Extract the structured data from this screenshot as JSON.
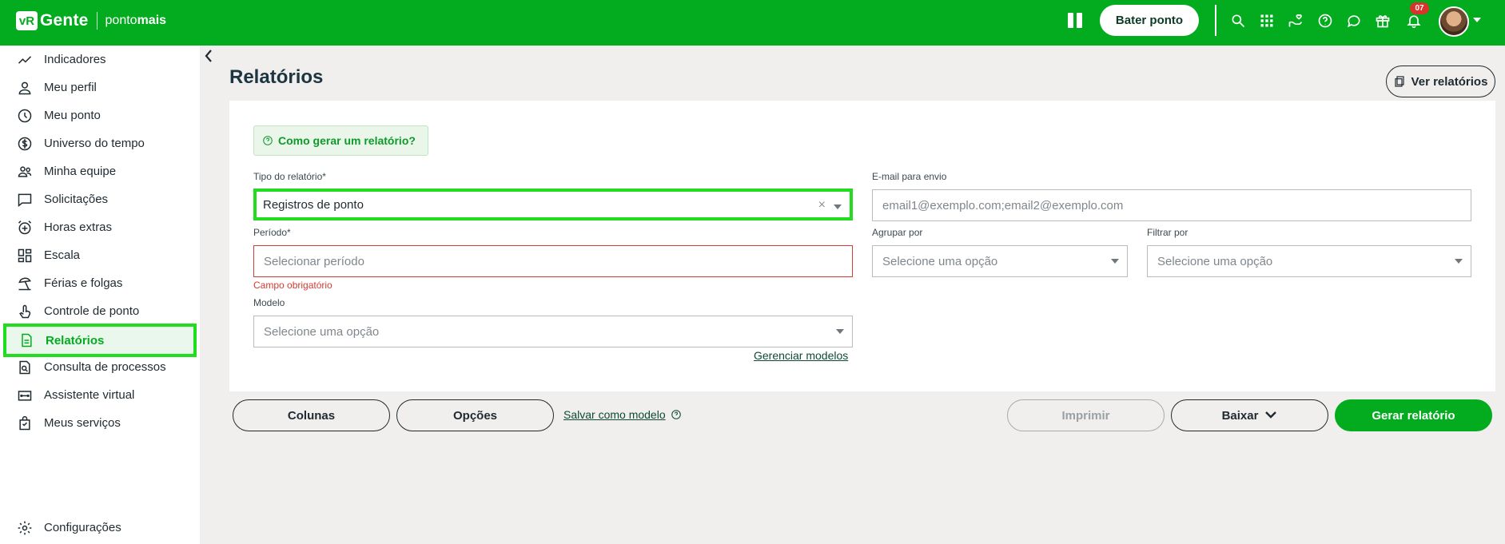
{
  "brand": {
    "logo_text": "vR",
    "name": "Gente",
    "sub_prefix": "ponto",
    "sub_bold": "mais"
  },
  "topbar": {
    "bater_ponto_label": "Bater ponto",
    "notifications_count": "07",
    "icons": [
      "pause-icon",
      "search-icon",
      "apps-grid-icon",
      "hand-heart-icon",
      "help-circle-icon",
      "chat-icon",
      "gift-icon",
      "bell-icon"
    ]
  },
  "sidebar": {
    "items": [
      {
        "label": "Indicadores",
        "icon": "trend-icon"
      },
      {
        "label": "Meu perfil",
        "icon": "person-icon"
      },
      {
        "label": "Meu ponto",
        "icon": "clock-icon"
      },
      {
        "label": "Universo do tempo",
        "icon": "dollar-icon"
      },
      {
        "label": "Minha equipe",
        "icon": "team-icon"
      },
      {
        "label": "Solicitações",
        "icon": "chat-dots-icon"
      },
      {
        "label": "Horas extras",
        "icon": "alarm-plus-icon"
      },
      {
        "label": "Escala",
        "icon": "grid-schedule-icon"
      },
      {
        "label": "Férias e folgas",
        "icon": "beach-icon"
      },
      {
        "label": "Controle de ponto",
        "icon": "fingerprint-hand-icon"
      },
      {
        "label": "Relatórios",
        "icon": "document-icon",
        "active": true
      },
      {
        "label": "Consulta de processos",
        "icon": "doc-search-icon"
      },
      {
        "label": "Assistente virtual",
        "icon": "robot-icon"
      },
      {
        "label": "Meus serviços",
        "icon": "bag-icon"
      }
    ],
    "footer_label": "Configurações"
  },
  "page": {
    "title": "Relatórios",
    "ver_relatorios_label": "Ver relatórios",
    "help_label": "Como gerar um relatório?"
  },
  "form": {
    "tipo_label": "Tipo do relatório*",
    "tipo_value": "Registros de ponto",
    "email_label": "E-mail para envio",
    "email_placeholder": "email1@exemplo.com;email2@exemplo.com",
    "periodo_label": "Período*",
    "periodo_placeholder": "Selecionar período",
    "periodo_error": "Campo obrigatório",
    "agrupar_label": "Agrupar por",
    "agrupar_placeholder": "Selecione uma opção",
    "filtrar_label": "Filtrar por",
    "filtrar_placeholder": "Selecione uma opção",
    "modelo_label": "Modelo",
    "modelo_placeholder": "Selecione uma opção",
    "gerenciar_label": "Gerenciar modelos"
  },
  "actions": {
    "colunas": "Colunas",
    "opcoes": "Opções",
    "salvar_modelo": "Salvar como modelo",
    "imprimir": "Imprimir",
    "baixar": "Baixar",
    "gerar": "Gerar relatório"
  },
  "colors": {
    "brand_green": "#03ac1f",
    "highlight_green": "#22dd1f",
    "error_red": "#d33c33"
  }
}
